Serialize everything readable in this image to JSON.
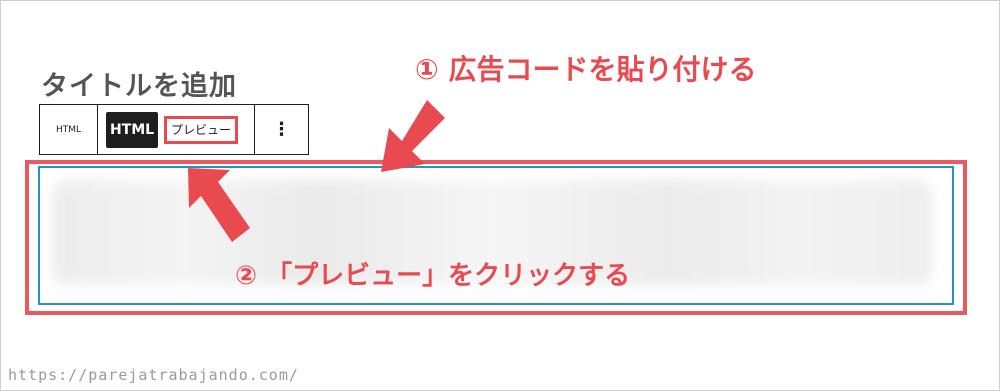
{
  "editor": {
    "title_placeholder": "タイトルを追加",
    "toolbar": {
      "block_type_label": "HTML",
      "html_tab_label": "HTML",
      "preview_tab_label": "プレビュー",
      "more_options_label": "⋮"
    }
  },
  "annotations": {
    "step1": "① 広告コードを貼り付ける",
    "step2": "② 「プレビュー」をクリックする"
  },
  "footer": {
    "url": "https://parejatrabajando.com/"
  },
  "colors": {
    "annotation_red": "#e84a4f",
    "editor_border_blue": "#2b8fc7",
    "toolbar_dark": "#1e1e1e"
  }
}
